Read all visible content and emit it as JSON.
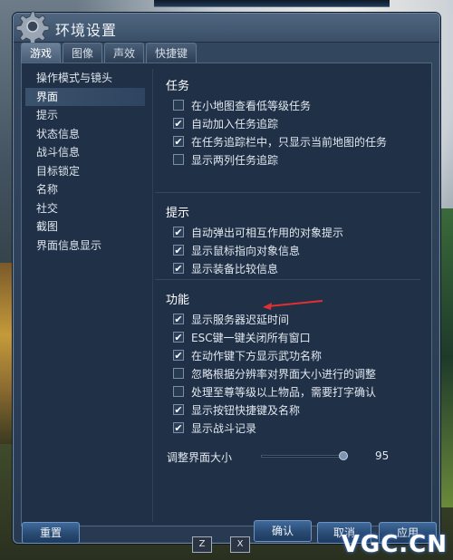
{
  "window": {
    "title": "环境设置"
  },
  "tabs": [
    {
      "label": "游戏",
      "active": true
    },
    {
      "label": "图像",
      "active": false
    },
    {
      "label": "声效",
      "active": false
    },
    {
      "label": "快捷键",
      "active": false
    }
  ],
  "sidebar": {
    "items": [
      {
        "label": "操作模式与镜头",
        "selected": false
      },
      {
        "label": "界面",
        "selected": true
      },
      {
        "label": "提示",
        "selected": false
      },
      {
        "label": "状态信息",
        "selected": false
      },
      {
        "label": "战斗信息",
        "selected": false
      },
      {
        "label": "目标锁定",
        "selected": false
      },
      {
        "label": "名称",
        "selected": false
      },
      {
        "label": "社交",
        "selected": false
      },
      {
        "label": "截图",
        "selected": false
      },
      {
        "label": "界面信息显示",
        "selected": false
      }
    ]
  },
  "sections": {
    "task": {
      "title": "任务",
      "options": [
        {
          "label": "在小地图查看低等级任务",
          "checked": false
        },
        {
          "label": "自动加入任务追踪",
          "checked": true
        },
        {
          "label": "在任务追踪栏中，只显示当前地图的任务",
          "checked": true
        },
        {
          "label": "显示两列任务追踪",
          "checked": false
        }
      ]
    },
    "hint": {
      "title": "提示",
      "options": [
        {
          "label": "自动弹出可相互作用的对象提示",
          "checked": true
        },
        {
          "label": "显示鼠标指向对象信息",
          "checked": true
        },
        {
          "label": "显示装备比较信息",
          "checked": true
        }
      ]
    },
    "feature": {
      "title": "功能",
      "options": [
        {
          "label": "显示服务器迟延时间",
          "checked": true
        },
        {
          "label": "ESC键一键关闭所有窗口",
          "checked": true
        },
        {
          "label": "在动作键下方显示武功名称",
          "checked": true
        },
        {
          "label": "忽略根据分辨率对界面大小进行的调整",
          "checked": false
        },
        {
          "label": "处理至尊等级以上物品，需要打字确认",
          "checked": false
        },
        {
          "label": "显示按钮快捷键及名称",
          "checked": true
        },
        {
          "label": "显示战斗记录",
          "checked": true
        }
      ]
    }
  },
  "slider": {
    "label": "调整界面大小",
    "value": "95",
    "fraction": 0.95
  },
  "buttons": {
    "reset": "重置",
    "confirm": "确认",
    "cancel": "取消",
    "apply": "应用"
  },
  "hud": {
    "keys": [
      "Z",
      "X"
    ]
  },
  "watermark": "VGC.CN",
  "colors": {
    "accent_arrow": "#e03030",
    "button_blue": "#294a73",
    "panel_bg": "#1f3047"
  }
}
